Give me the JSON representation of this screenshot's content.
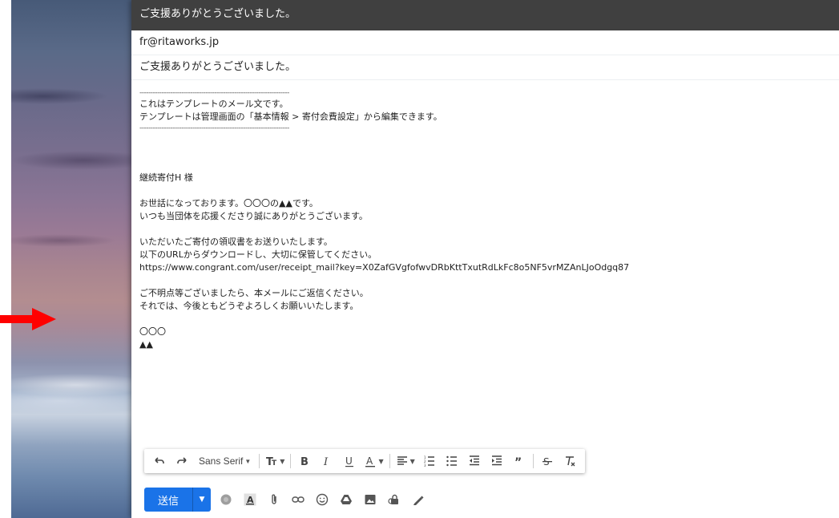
{
  "window": {
    "title": "ご支援ありがとうございました。"
  },
  "fields": {
    "to": "fr@ritaworks.jp",
    "subject": "ご支援ありがとうございました。"
  },
  "body": {
    "dash_top": "--------------------------------------------------------------------",
    "template_notice_1": "これはテンプレートのメール文です。",
    "template_notice_2": "テンプレートは管理画面の「基本情報 > 寄付会費設定」から編集できます。",
    "dash_bottom": "--------------------------------------------------------------------",
    "addressee": "継続寄付H 様",
    "greeting_1": "お世話になっております。〇〇〇の▲▲です。",
    "greeting_2": "いつも当団体を応援くださり誠にありがとうございます。",
    "receipt_1": "いただいたご寄付の領収書をお送りいたします。",
    "receipt_2": "以下のURLからダウンロードし、大切に保管してください。",
    "receipt_url": "https://www.congrant.com/user/receipt_mail?key=X0ZafGVgfofwvDRbKttTxutRdLkFc8o5NF5vrMZAnLJoOdgq87",
    "closing_1": "ご不明点等ございましたら、本メールにご返信ください。",
    "closing_2": "それでは、今後ともどうぞよろしくお願いいたします。",
    "sign_org": "〇〇〇",
    "sign_name": "▲▲"
  },
  "toolbar": {
    "font_name": "Sans Serif",
    "items": [
      "undo-icon",
      "redo-icon",
      "font-family",
      "text-size-icon",
      "bold-icon",
      "italic-icon",
      "underline-icon",
      "text-color-icon",
      "align-icon",
      "numbered-list-icon",
      "bulleted-list-icon",
      "indent-less-icon",
      "indent-more-icon",
      "quote-icon",
      "strikethrough-icon",
      "remove-formatting-icon"
    ]
  },
  "actions": {
    "send_label": "送信",
    "icons": [
      "more-send-options-icon",
      "formatting-options-icon",
      "attach-icon",
      "link-icon",
      "emoji-icon",
      "drive-icon",
      "photo-icon",
      "confidential-icon",
      "signature-icon"
    ]
  },
  "colors": {
    "titlebar": "#404040",
    "send_button": "#1a73e8",
    "arrow": "#ff0000"
  }
}
